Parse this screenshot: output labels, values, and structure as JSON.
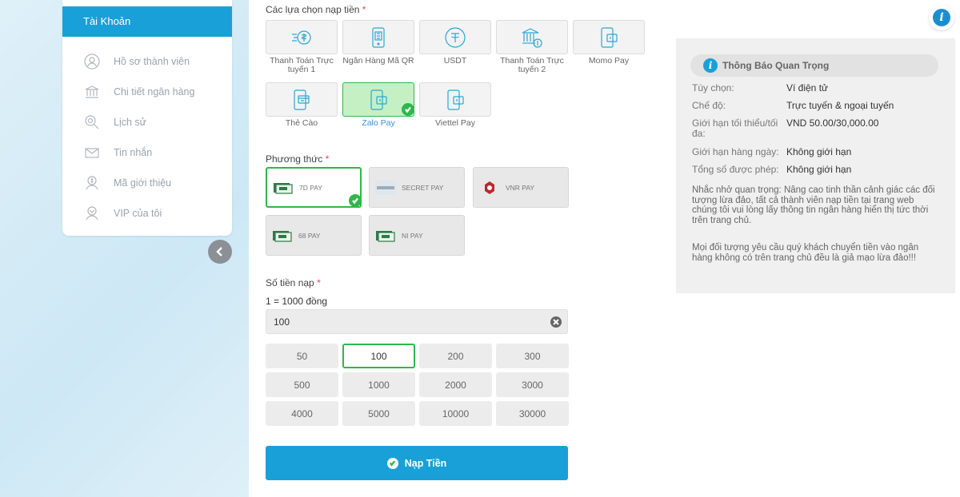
{
  "sidebar": {
    "header": "Tài Khoản",
    "items": [
      {
        "label": "Hồ sơ thành viên",
        "icon": "user-icon"
      },
      {
        "label": "Chi tiết ngân hàng",
        "icon": "bank-icon"
      },
      {
        "label": "Lịch sử",
        "icon": "search-history-icon"
      },
      {
        "label": "Tin nhắn",
        "icon": "mail-icon"
      },
      {
        "label": "Mã giới thiệu",
        "icon": "referral-icon"
      },
      {
        "label": "VIP của tôi",
        "icon": "vip-icon"
      }
    ]
  },
  "deposit": {
    "options_label": "Các lựa chọn nạp tiền",
    "required_mark": "*",
    "options": [
      {
        "label": "Thanh Toán Trực tuyến 1",
        "icon": "coin-transfer-icon",
        "selected": false
      },
      {
        "label": "Ngân Hàng Mã QR",
        "icon": "qr-phone-icon",
        "selected": false
      },
      {
        "label": "USDT",
        "icon": "usdt-icon",
        "selected": false
      },
      {
        "label": "Thanh Toán Trực tuyến 2",
        "icon": "bank-transfer-icon",
        "selected": false
      },
      {
        "label": "Momo Pay",
        "icon": "wallet-phone-icon",
        "selected": false
      },
      {
        "label": "Thẻ Cào",
        "icon": "card-phone-icon",
        "selected": false
      },
      {
        "label": "Zalo Pay",
        "icon": "wallet-phone-icon",
        "selected": true
      },
      {
        "label": "Viettel Pay",
        "icon": "wallet-phone-icon",
        "selected": false
      }
    ],
    "method_label": "Phương thức",
    "methods": [
      {
        "label": "7D PAY",
        "selected": true
      },
      {
        "label": "SECRET PAY",
        "selected": false
      },
      {
        "label": "VNR PAY",
        "selected": false
      },
      {
        "label": "68 PAY",
        "selected": false
      },
      {
        "label": "NI PAY",
        "selected": false
      }
    ],
    "amount_label": "Số tiền nạp",
    "rate": "1 = 1000 đồng",
    "amount_value": "100",
    "amounts": [
      "50",
      "100",
      "200",
      "300",
      "500",
      "1000",
      "2000",
      "3000",
      "4000",
      "5000",
      "10000",
      "30000"
    ],
    "selected_amount": "100",
    "submit_label": "Nạp Tiền"
  },
  "info": {
    "title": "Thông Báo Quan Trọng",
    "rows": [
      {
        "k": "Tùy chọn:",
        "v": "Ví điện tử"
      },
      {
        "k": "Chế độ:",
        "v": "Trực tuyến & ngoại tuyến"
      },
      {
        "k": "Giới hạn tối thiểu/tối đa:",
        "v": "VND 50.00/30,000.00"
      },
      {
        "k": "Giới hạn hàng ngày:",
        "v": "Không giới hạn"
      },
      {
        "k": "Tổng số được phép:",
        "v": "Không giới hạn"
      }
    ],
    "note1": "Nhắc nhở quan trọng: Nâng cao tinh thần cảnh giác các đối tượng lừa đảo, tất cả thành viên nạp tiền tại trang web chúng tôi vui lòng lấy thông tin ngân hàng hiển thị tức thời trên trang chủ.",
    "note2": "Mọi đối tượng yêu cầu quý khách chuyển tiền vào ngân hàng không có trên trang chủ đều là giả mạo lừa đảo!!!"
  },
  "fab_glyph": "i",
  "colors": {
    "accent": "#1aa0d8",
    "success": "#2fb84a",
    "required": "#e5484d"
  }
}
